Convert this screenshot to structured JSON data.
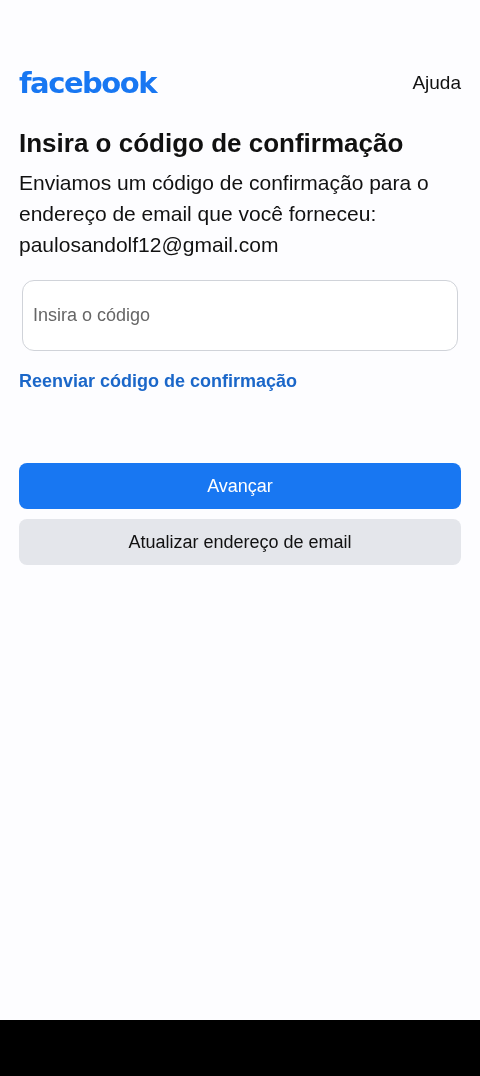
{
  "header": {
    "logo": "facebook",
    "help_link": "Ajuda"
  },
  "title": "Insira o código de confirmação",
  "description": "Enviamos um código de confirmação para o endereço de email que você forneceu: paulosandolf12@gmail.com",
  "code_field": {
    "placeholder": "Insira o código"
  },
  "resend_link": "Reenviar código de confirmação",
  "buttons": [
    {
      "kind": "primary",
      "label": "Avançar"
    },
    {
      "kind": "secondary",
      "label": "Atualizar endereço de email"
    }
  ]
}
